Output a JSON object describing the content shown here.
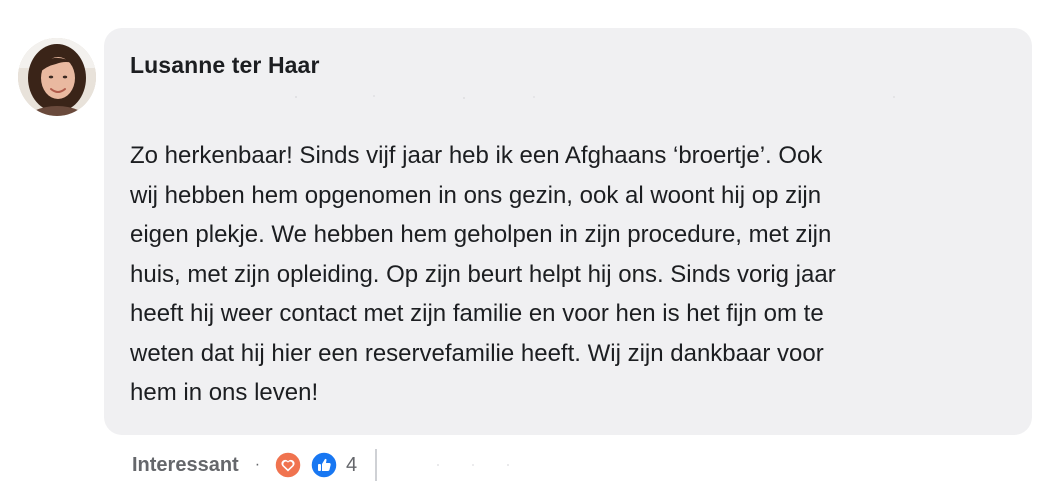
{
  "comment": {
    "author": "Lusanne ter Haar",
    "text": "Zo herkenbaar! Sinds vijf jaar heb ik een Afghaans ‘broertje’. Ook\nwij hebben hem opgenomen in ons gezin, ook al woont hij op zijn\neigen plekje. We hebben hem geholpen in zijn procedure, met zijn\nhuis, met zijn opleiding. Op zijn beurt helpt hij ons. Sinds vorig jaar\nheeft hij weer contact met zijn familie en voor hen is het fijn om te\nweten dat hij hier een reservefamilie heeft. Wij zijn dankbaar voor\nhem in ons leven!"
  },
  "actions": {
    "reaction_label": "Interessant",
    "separator": "·",
    "reaction_count": "4"
  },
  "icons": {
    "avatar": "profile-photo",
    "love": "heart-icon",
    "like": "thumbs-up-icon"
  },
  "colors": {
    "bubble": "#f0f0f2",
    "text": "#1c1e21",
    "muted": "#65676b",
    "love": "#f0734f",
    "like": "#1877f2"
  }
}
